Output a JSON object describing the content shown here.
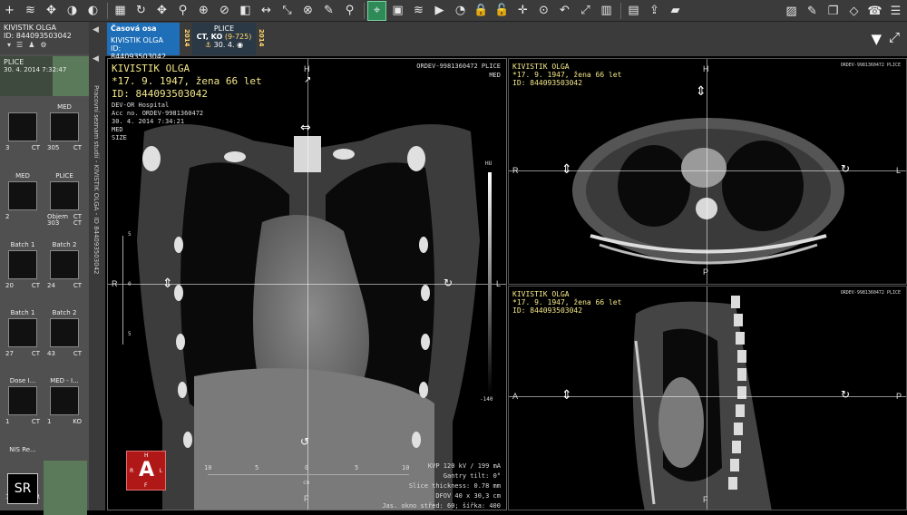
{
  "toolbar": {
    "left_icons": [
      "add-icon",
      "layers-icon",
      "move-icon",
      "contrast-icon",
      "window-level-icon",
      "grid-layout-icon",
      "rotate-icon",
      "pan-icon",
      "zoom-icon",
      "zoom-region-icon",
      "invert-icon",
      "half-contrast-icon",
      "distance-icon",
      "axes-icon",
      "reset-icon",
      "no-annotations-icon",
      "pin-icon",
      "select-icon",
      "save-icon",
      "stack-icon",
      "play-icon",
      "cine-icon",
      "lock-icon",
      "lock2-icon",
      "crosshair-icon",
      "target-icon",
      "undo-icon",
      "xy-icon",
      "compare-icon",
      "pdf-icon",
      "export-icon",
      "folder-icon"
    ],
    "right_icons": [
      "image-icon",
      "pencil-icon",
      "windows-icon",
      "cube-icon",
      "phone-icon",
      "menu-icon"
    ]
  },
  "left_panel": {
    "patient_name": "KIVISTIK OLGA",
    "patient_id": "ID: 844093503042",
    "study_body_part": "PLICE",
    "study_date": "30. 4. 2014 7:32:47",
    "series": [
      {
        "caption": "",
        "num": "3",
        "mod": "CT"
      },
      {
        "caption": "MED",
        "num": "305",
        "mod": "CT"
      },
      {
        "caption": "MED",
        "num": "2",
        "mod": ""
      },
      {
        "caption": "PLICE",
        "num": "Objem",
        "mod": "CT"
      },
      {
        "caption": "",
        "num": "303",
        "mod": "CT"
      },
      {
        "caption": "Batch 1",
        "num": "20",
        "mod": "CT"
      },
      {
        "caption": "Batch 2",
        "num": "24",
        "mod": "CT"
      },
      {
        "caption": "Batch 1",
        "num": "27",
        "mod": "CT"
      },
      {
        "caption": "Batch 2",
        "num": "43",
        "mod": "CT"
      },
      {
        "caption": "Dose I...",
        "num": "1",
        "mod": "CT"
      },
      {
        "caption": "MED - I...",
        "num": "1",
        "mod": "KO"
      },
      {
        "caption": "NIS Re...",
        "num": "1",
        "mod": "SR"
      }
    ],
    "sr_label": "SR"
  },
  "timeline_strip": {
    "vertical_text": "Pracovní seznam studií - KIVISTIK OLGA - ID 844093503042"
  },
  "tabs": [
    {
      "title": "Časová osa",
      "patient": "KIVISTIK OLGA",
      "id": "ID: 844093503042",
      "year": "2014"
    },
    {
      "title": "PLICE",
      "sub": "CT, KO",
      "sub2": "(9-725)",
      "date": "30. 4.",
      "year": "2014"
    }
  ],
  "viewport_main": {
    "name": "KIVISTIK OLGA",
    "dob": "*17. 9. 1947, žena 66 let",
    "id": "ID: 844093503042",
    "hospital": "DEV-OR Hospital",
    "acc": "Acc no. ORDEV-9981360472",
    "datetime": "30. 4. 2014 7:34:21",
    "series_name": "MED",
    "extra": "SIZE",
    "top_right": "ORDEV-9981360472 PLICE",
    "top_right2": "MED",
    "orient_top": "H",
    "orient_left": "R",
    "orient_right": "L",
    "orient_bottom": "F",
    "scale_labels": [
      "10",
      "5",
      "0",
      "5",
      "10"
    ],
    "scale_unit": "cm",
    "vscale_labels": [
      "5",
      "0",
      "5"
    ],
    "bar_top": "HU",
    "bar_bottom": "-140",
    "bottom_info": [
      "KVP 120 kV / 199 mA",
      "Gantry tilt: 0°",
      "Slice thickness: 0.78 mm",
      "DFOV 40 x 30,3 cm",
      "Jas. okno střed: 60; šířka: 400"
    ]
  },
  "viewport_axial": {
    "name": "KIVISTIK OLGA",
    "dob": "*17. 9. 1947, žena 66 let",
    "id": "ID: 844093503042",
    "top_right": "ORDEV-9981360472 PLICE",
    "orient_top": "H",
    "orient_left": "R",
    "orient_right": "L",
    "orient_bottom": "P"
  },
  "viewport_sagittal": {
    "name": "KIVISTIK OLGA",
    "dob": "*17. 9. 1947, žena 66 let",
    "id": "ID: 844093503042",
    "top_right": "ORDEV-9981360472 PLICE",
    "orient_left": "A",
    "orient_right": "P",
    "orient_bottom": "F"
  },
  "orientation_cube": {
    "top": "H",
    "left": "R",
    "center": "A",
    "right": "L",
    "bottom": "F"
  },
  "colors": {
    "toolbar_bg": "#3b3b3b",
    "tab_active": "#1e6fb8",
    "overlay_text": "#f4e88a",
    "cube_red": "#b01818",
    "active_tool": "#2e8b57"
  }
}
